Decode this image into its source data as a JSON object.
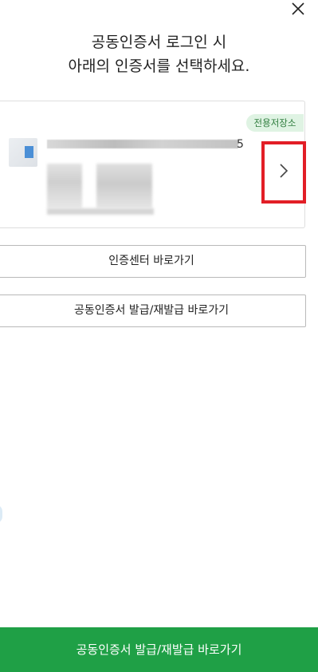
{
  "header": {
    "close_icon": "close-icon",
    "title_line1": "공동인증서 로그인 시",
    "title_line2": "아래의 인증서를 선택하세요."
  },
  "certificate": {
    "badge": "전용저장소",
    "trailing_char": "5",
    "next_icon": "chevron-right-icon",
    "highlight_color": "#e21e26",
    "badge_color": "#dff3e3"
  },
  "buttons": {
    "cert_center": "인증센터 바로가기",
    "issue_reissue": "공동인증서 발급/재발급 바로가기",
    "bottom_cta": "공동인증서 발급/재발급 바로가기",
    "bottom_cta_color": "#1fa046"
  }
}
